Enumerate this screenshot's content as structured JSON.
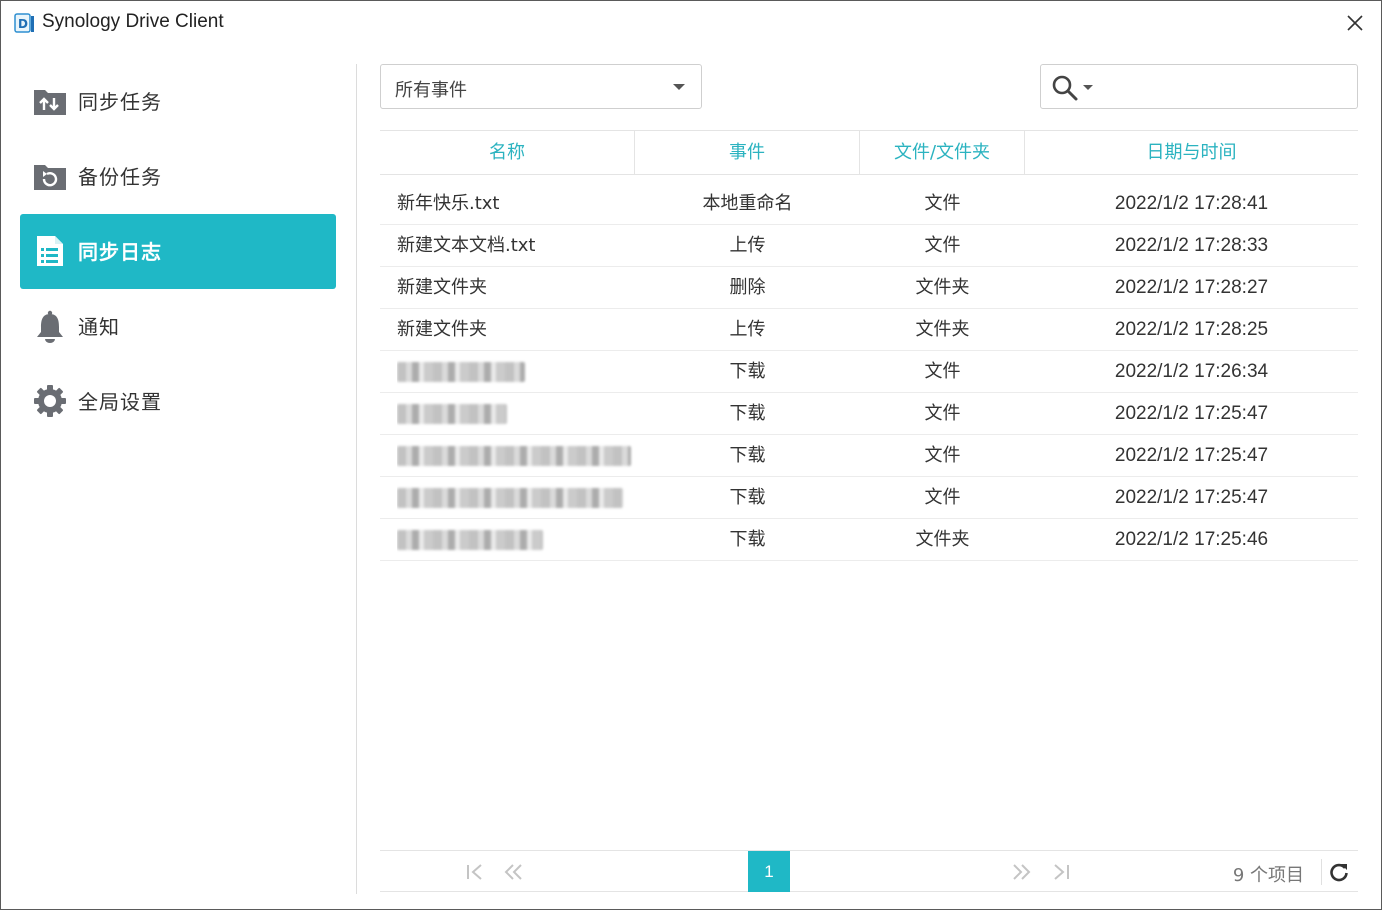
{
  "window": {
    "title": "Synology Drive Client"
  },
  "sidebar": {
    "items": [
      {
        "label": "同步任务",
        "icon": "sync-tasks-icon",
        "active": false
      },
      {
        "label": "备份任务",
        "icon": "backup-tasks-icon",
        "active": false
      },
      {
        "label": "同步日志",
        "icon": "sync-log-icon",
        "active": true
      },
      {
        "label": "通知",
        "icon": "bell-icon",
        "active": false
      },
      {
        "label": "全局设置",
        "icon": "gear-icon",
        "active": false
      }
    ]
  },
  "filter": {
    "selected": "所有事件"
  },
  "search": {
    "value": ""
  },
  "table": {
    "columns": [
      "名称",
      "事件",
      "文件/文件夹",
      "日期与时间"
    ],
    "rows": [
      {
        "name": "新年快乐.txt",
        "event": "本地重命名",
        "type": "文件",
        "datetime": "2022/1/2 17:28:41"
      },
      {
        "name": "新建文本文档.txt",
        "event": "上传",
        "type": "文件",
        "datetime": "2022/1/2 17:28:33"
      },
      {
        "name": "新建文件夹",
        "event": "删除",
        "type": "文件夹",
        "datetime": "2022/1/2 17:28:27"
      },
      {
        "name": "新建文件夹",
        "event": "上传",
        "type": "文件夹",
        "datetime": "2022/1/2 17:28:25"
      },
      {
        "name": "",
        "event": "下载",
        "type": "文件",
        "datetime": "2022/1/2 17:26:34"
      },
      {
        "name": "",
        "event": "下载",
        "type": "文件",
        "datetime": "2022/1/2 17:25:47"
      },
      {
        "name": "",
        "event": "下载",
        "type": "文件",
        "datetime": "2022/1/2 17:25:47"
      },
      {
        "name": "",
        "event": "下载",
        "type": "文件",
        "datetime": "2022/1/2 17:25:47"
      },
      {
        "name": "",
        "event": "下载",
        "type": "文件夹",
        "datetime": "2022/1/2 17:25:46"
      }
    ]
  },
  "pager": {
    "current_page": "1",
    "item_count": "9 个项目"
  },
  "colors": {
    "accent": "#1fb8c6",
    "header_text": "#2bb3c0"
  }
}
